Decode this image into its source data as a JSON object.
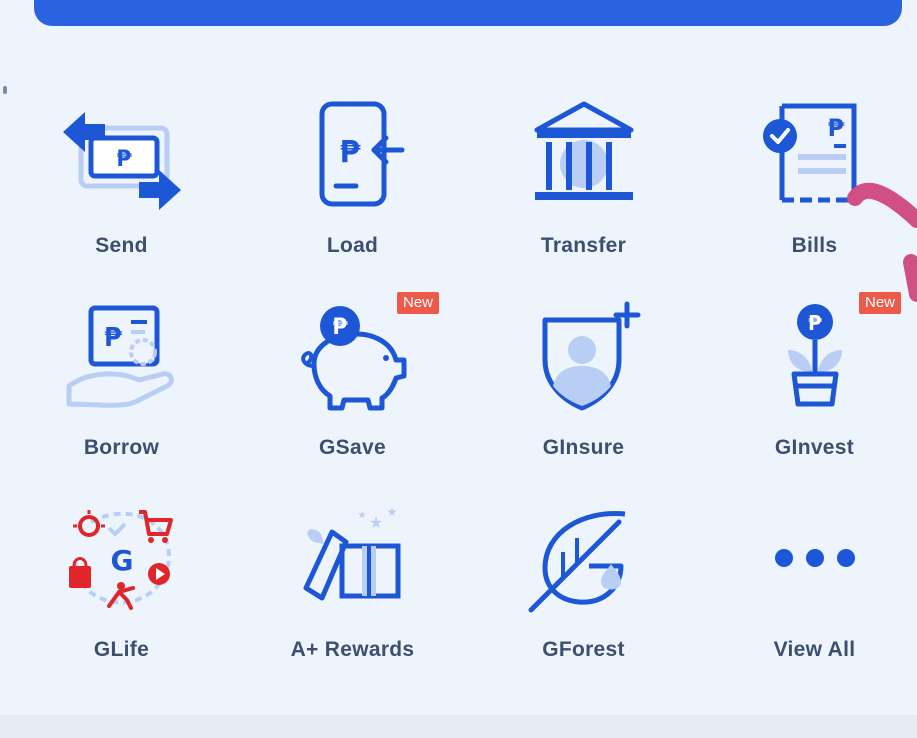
{
  "services": [
    {
      "label": "Send",
      "icon": "send-icon"
    },
    {
      "label": "Load",
      "icon": "load-icon"
    },
    {
      "label": "Transfer",
      "icon": "transfer-bank-icon"
    },
    {
      "label": "Bills",
      "icon": "bills-icon"
    },
    {
      "label": "Borrow",
      "icon": "borrow-icon"
    },
    {
      "label": "GSave",
      "icon": "gsave-piggy-icon",
      "badge": "New"
    },
    {
      "label": "GInsure",
      "icon": "ginsure-shield-icon"
    },
    {
      "label": "GInvest",
      "icon": "ginvest-plant-icon",
      "badge": "New"
    },
    {
      "label": "GLife",
      "icon": "glife-icon"
    },
    {
      "label": "A+ Rewards",
      "icon": "rewards-gift-icon"
    },
    {
      "label": "GForest",
      "icon": "gforest-leaf-icon"
    },
    {
      "label": "View All",
      "icon": "more-dots-icon"
    }
  ],
  "colors": {
    "primary": "#1d57d6",
    "light": "#b9cef4",
    "red": "#e0262a",
    "badge": "#ee5a4a",
    "label": "#3d4f6f"
  }
}
